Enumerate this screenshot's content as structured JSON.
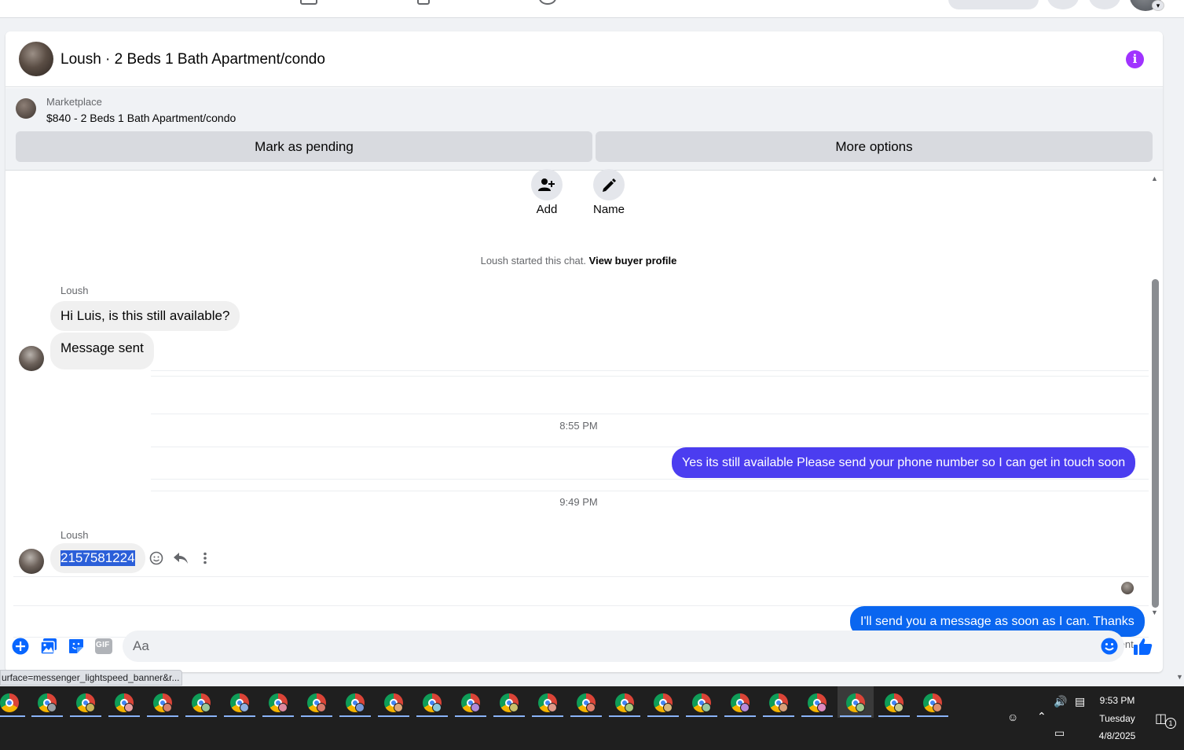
{
  "header": {
    "title": "Loush · 2 Beds 1 Bath Apartment/condo"
  },
  "listing": {
    "source": "Marketplace",
    "price_title": "$840 - 2 Beds 1 Bath Apartment/condo",
    "mark_pending_label": "Mark as pending",
    "more_options_label": "More options"
  },
  "actions": {
    "add_label": "Add",
    "name_label": "Name"
  },
  "chat_start": {
    "text": "Loush started this chat.",
    "link": "View buyer profile"
  },
  "messages": {
    "m1_sender": "Loush",
    "m1_text": "Hi Luis, is this still available?",
    "m2_text": "Message sent",
    "t1": "8:55 PM",
    "m3_text": "Yes its still available Please send your phone number so I can get in touch soon",
    "t2": "9:49 PM",
    "m4_sender": "Loush",
    "m4_text": "2157581224",
    "m5_text": "I'll send you a message as soon as I can. Thanks",
    "status": "Sent"
  },
  "composer": {
    "placeholder": "Aa",
    "gif_label": "GIF"
  },
  "browser_status": {
    "url": "urface=messenger_lightspeed_banner&r..."
  },
  "taskbar": {
    "time": "9:53 PM",
    "day": "Tuesday",
    "date": "4/8/2025",
    "notification_count": "1"
  },
  "colors": {
    "accent_purple": "#a033ff",
    "bubble_purple": "#4b3df0",
    "bubble_blue": "#0a66f0",
    "messenger_blue": "#0866ff",
    "selection": "#2b5fd9"
  }
}
